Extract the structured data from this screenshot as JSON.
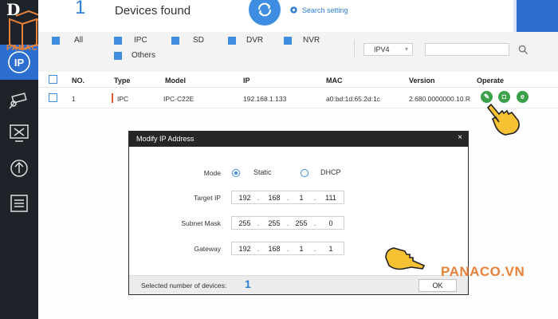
{
  "topbar": {
    "device_count": "1",
    "devices_found_label": "Devices found",
    "search_setting_label": "Search setting"
  },
  "logo": {
    "text": "PANACO"
  },
  "filters": {
    "all": "All",
    "ipc": "IPC",
    "sd": "SD",
    "dvr": "DVR",
    "nvr": "NVR",
    "others": "Others",
    "ip_version": "IPV4",
    "search_value": ""
  },
  "table": {
    "headers": [
      "NO.",
      "Type",
      "Model",
      "IP",
      "MAC",
      "Version",
      "Operate"
    ],
    "rows": [
      {
        "no": "1",
        "type": "IPC",
        "model": "IPC-C22E",
        "ip": "192.168.1.133",
        "mac": "a0:bd:1d:65:2d:1c",
        "version": "2.680.0000000.10.R"
      }
    ]
  },
  "modal": {
    "title": "Modify IP Address",
    "close": "×",
    "mode_label": "Mode",
    "mode_static": "Static",
    "mode_dhcp": "DHCP",
    "target_ip_label": "Target IP",
    "subnet_mask_label": "Subnet Mask",
    "gateway_label": "Gateway",
    "target_ip": [
      "192",
      "168",
      "1",
      "111"
    ],
    "subnet_mask": [
      "255",
      "255",
      "255",
      "0"
    ],
    "gateway": [
      "192",
      "168",
      "1",
      "1"
    ],
    "selected_label": "Selected number of devices:",
    "selected_count": "1",
    "ok_label": "OK"
  },
  "watermark": "PANACO.VN",
  "colors": {
    "accent": "#2f7fd4",
    "sidebar": "#1f2329",
    "brand_orange": "#e8823a",
    "operate_green": "#3aa04a"
  }
}
